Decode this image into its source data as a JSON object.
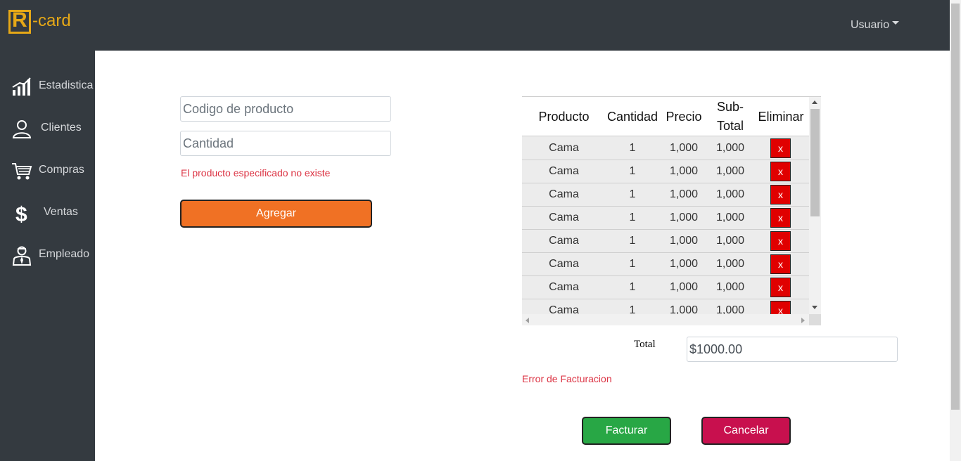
{
  "brand": {
    "logo_letter": "R",
    "logo_text": "-card",
    "color": "#e6a817"
  },
  "header": {
    "user_menu_label": "Usuario"
  },
  "sidebar": {
    "items": [
      {
        "label": "Estadistica",
        "icon": "bar-chart-icon"
      },
      {
        "label": "Clientes",
        "icon": "user-icon"
      },
      {
        "label": "Compras",
        "icon": "cart-icon"
      },
      {
        "label": "Ventas",
        "icon": "dollar-icon"
      },
      {
        "label": "Empleado",
        "icon": "employee-icon"
      }
    ]
  },
  "form": {
    "product_code_placeholder": "Codigo de producto",
    "quantity_placeholder": "Cantidad",
    "error_message": "El producto especificado no existe",
    "add_button": "Agregar"
  },
  "table": {
    "headers": {
      "product": "Producto",
      "quantity": "Cantidad",
      "price": "Precio",
      "subtotal": "Sub-Total",
      "delete": "Eliminar"
    },
    "rows": [
      {
        "product": "Cama",
        "quantity": "1",
        "price": "1,000",
        "subtotal": "1,000",
        "delete": "x"
      },
      {
        "product": "Cama",
        "quantity": "1",
        "price": "1,000",
        "subtotal": "1,000",
        "delete": "x"
      },
      {
        "product": "Cama",
        "quantity": "1",
        "price": "1,000",
        "subtotal": "1,000",
        "delete": "x"
      },
      {
        "product": "Cama",
        "quantity": "1",
        "price": "1,000",
        "subtotal": "1,000",
        "delete": "x"
      },
      {
        "product": "Cama",
        "quantity": "1",
        "price": "1,000",
        "subtotal": "1,000",
        "delete": "x"
      },
      {
        "product": "Cama",
        "quantity": "1",
        "price": "1,000",
        "subtotal": "1,000",
        "delete": "x"
      },
      {
        "product": "Cama",
        "quantity": "1",
        "price": "1,000",
        "subtotal": "1,000",
        "delete": "x"
      },
      {
        "product": "Cama",
        "quantity": "1",
        "price": "1,000",
        "subtotal": "1,000",
        "delete": "x"
      }
    ]
  },
  "total": {
    "label": "Total",
    "value": "$1000.00"
  },
  "billing_error": "Error de Facturacion",
  "actions": {
    "invoice_button": "Facturar",
    "cancel_button": "Cancelar"
  },
  "colors": {
    "nav_bg": "#343a40",
    "add_button": "#f07124",
    "invoice_button": "#28a745",
    "cancel_button": "#c8104e",
    "error": "#dc3545",
    "delete": "#e00000"
  }
}
